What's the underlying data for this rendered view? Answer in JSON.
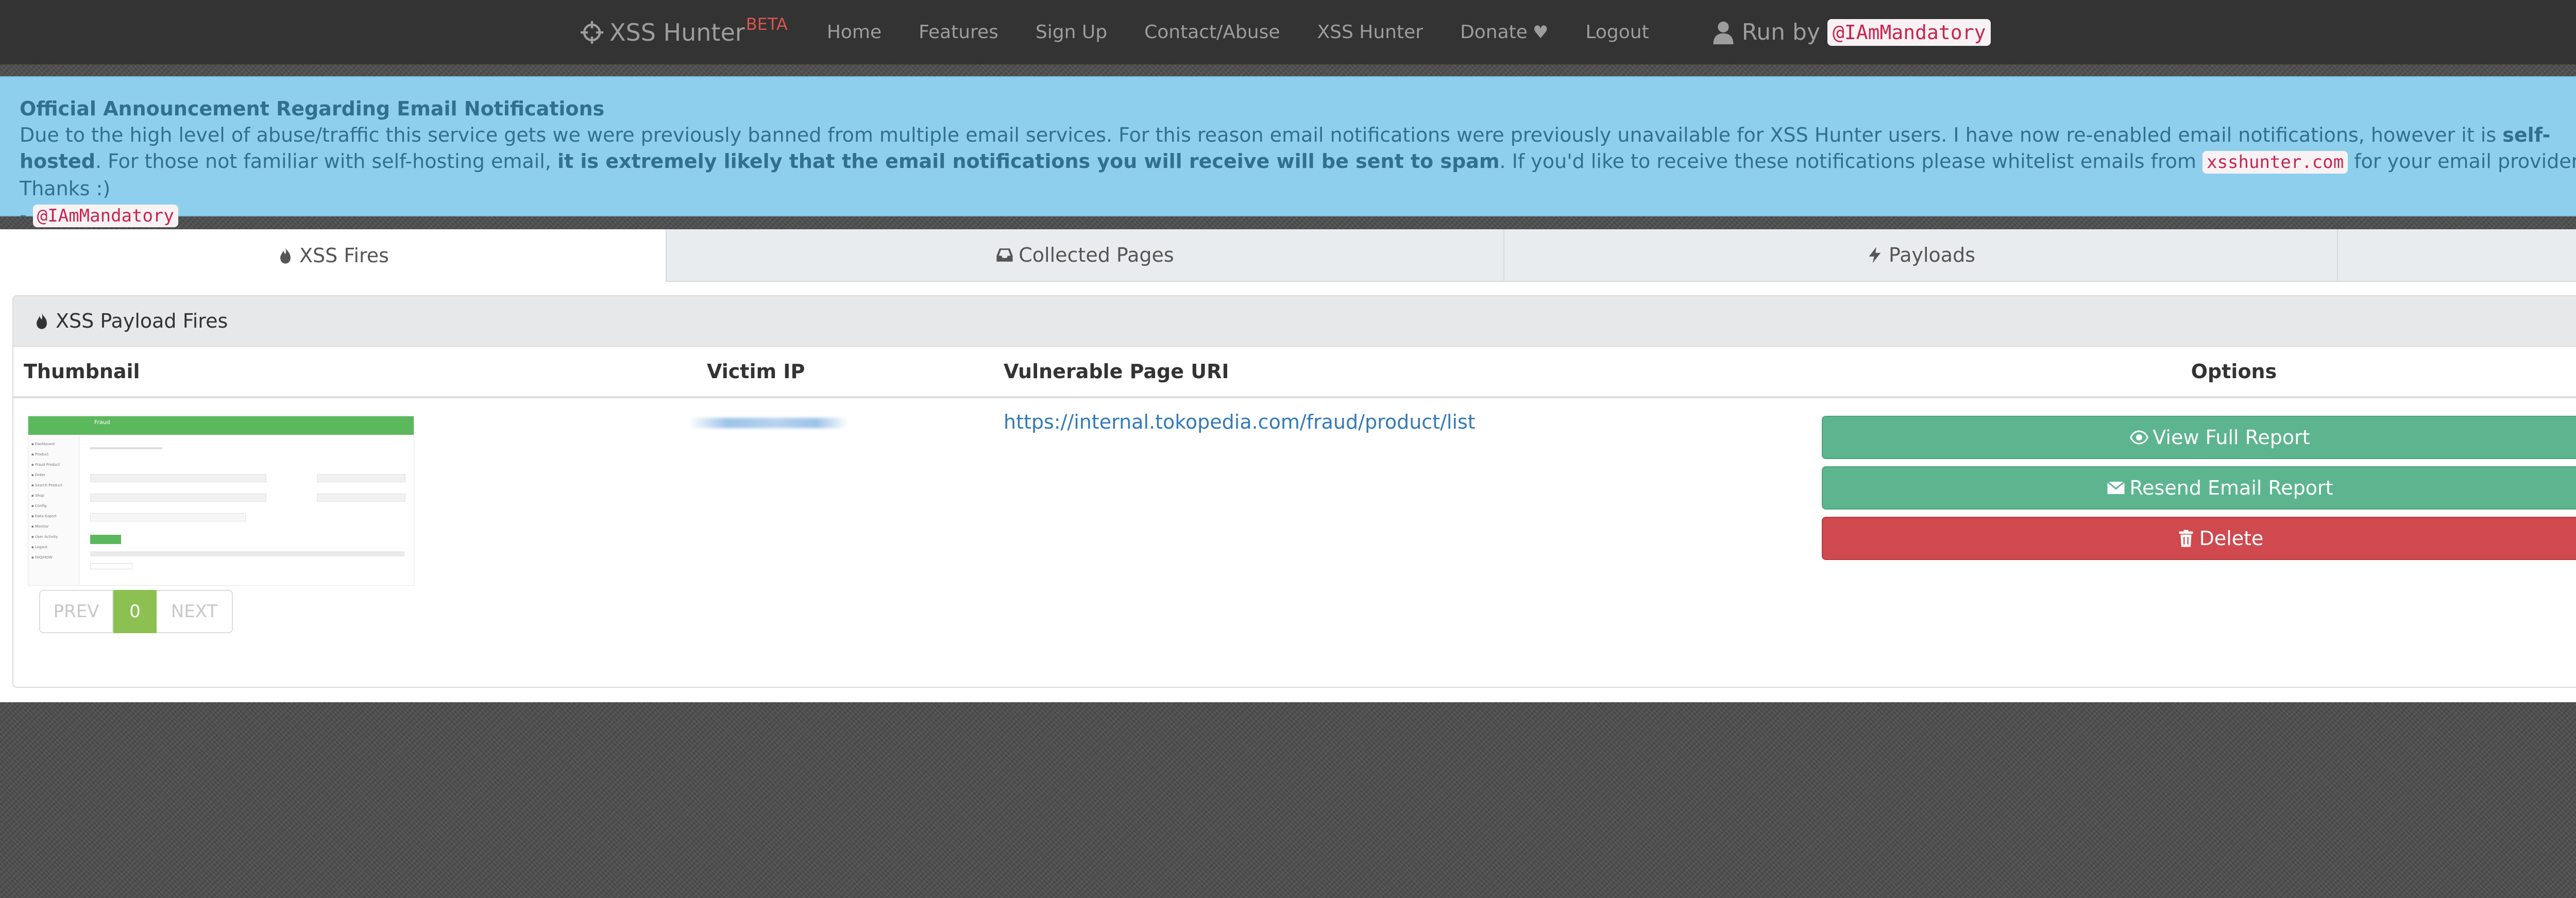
{
  "navbar": {
    "brand": "XSS Hunter",
    "brand_badge": "BETA",
    "links": [
      "Home",
      "Features",
      "Sign Up",
      "Contact/Abuse",
      "XSS Hunter",
      "Donate",
      "Logout"
    ],
    "run_by_label": "Run by",
    "run_by_handle": "@IAmMandatory"
  },
  "announcement": {
    "title": "Official Announcement Regarding Email Notifications",
    "text_1": "Due to the high level of abuse/traffic this service gets we were previously banned from multiple email services. For this reason email notifications were previously unavailable for XSS Hunter users. I have now re-enabled email notifications, however it is ",
    "bold_1": "self-hosted",
    "text_2": ". For those not familiar with self-hosting email, ",
    "bold_2": "it is extremely likely that the email notifications you will receive will be sent to spam",
    "text_3": ". If you'd like to receive these notifications please whitelist emails from ",
    "domain": "xsshunter.com",
    "text_4": " for your email provider. Thanks :)",
    "sign_prefix": "- ",
    "sign_handle": "@IAmMandatory"
  },
  "tabs": [
    "XSS Fires",
    "Collected Pages",
    "Payloads"
  ],
  "panel": {
    "title": "XSS Payload Fires",
    "columns": {
      "thumbnail": "Thumbnail",
      "victim_ip": "Victim IP",
      "uri": "Vulnerable Page URI",
      "options": "Options"
    },
    "rows": [
      {
        "uri": "https://internal.tokopedia.com/fraud/product/list",
        "thumbnail_title": "Fraud",
        "thumbnail_sidebar": [
          "Dashboard",
          "Product",
          "Fraud Product",
          "Order",
          "Search Product",
          "Shop",
          "Config",
          "Data Export",
          "Monitor",
          "User Activity",
          "Logout",
          "FAQ/HOW"
        ]
      }
    ],
    "buttons": {
      "view": "View Full Report",
      "resend": "Resend Email Report",
      "delete": "Delete"
    },
    "pager": {
      "prev": "PREV",
      "page": "0",
      "next": "NEXT"
    }
  },
  "colors": {
    "navbar": "#333333",
    "announcement_bg": "#8ecfee",
    "announcement_text": "#31708f",
    "button_green": "#5cb58f",
    "button_red": "#d0494f",
    "pager_active": "#8cc152",
    "link": "#337ab7",
    "brand_badge": "#d9534f"
  },
  "icons": {
    "brand": "crosshairs-icon",
    "donate": "heart-icon",
    "run_by": "user-icon",
    "tab_fires": "fire-icon",
    "tab_pages": "inbox-icon",
    "tab_payloads": "bolt-icon",
    "view": "eye-icon",
    "resend": "envelope-icon",
    "delete": "trash-icon"
  }
}
